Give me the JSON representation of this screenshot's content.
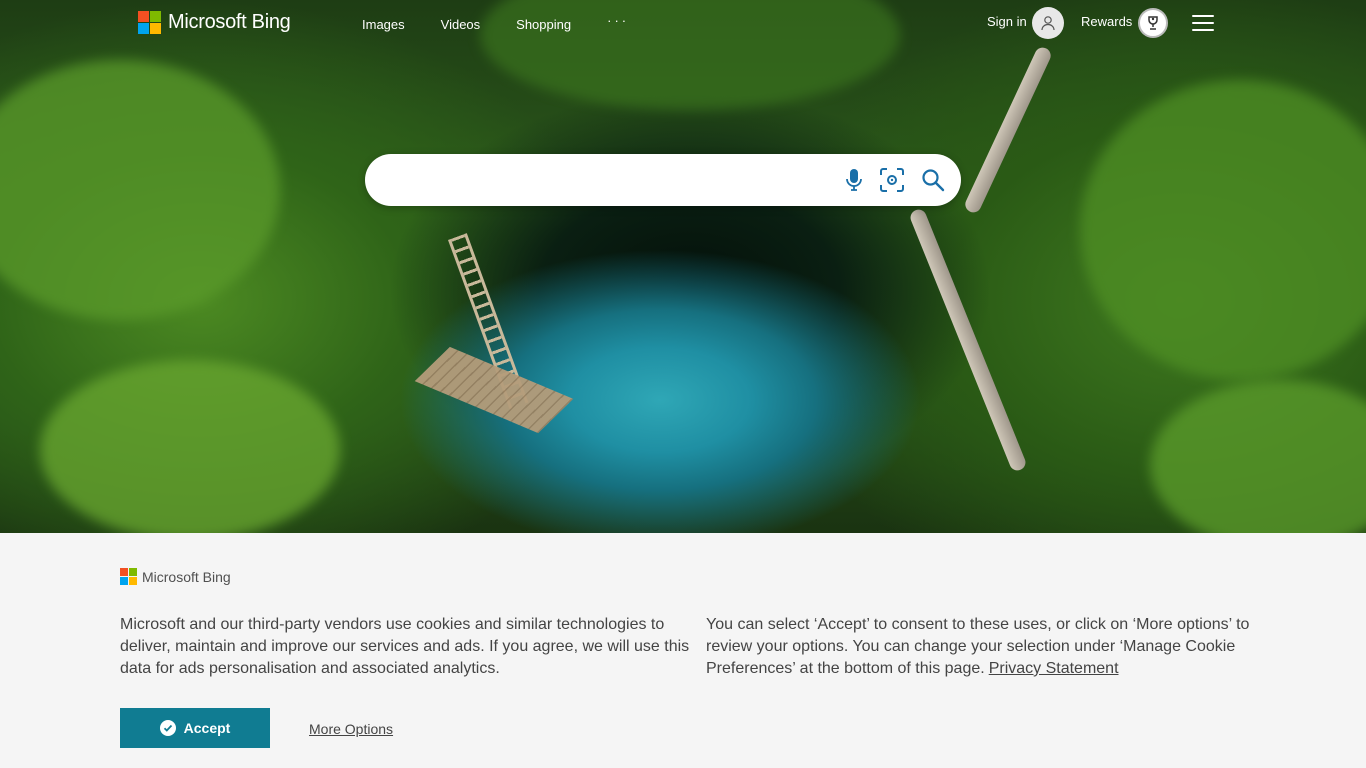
{
  "header": {
    "logo_text": "Microsoft Bing",
    "nav": [
      {
        "label": "Images"
      },
      {
        "label": "Videos"
      },
      {
        "label": "Shopping"
      }
    ],
    "more": "···",
    "signin": "Sign in",
    "rewards": "Rewards"
  },
  "search": {
    "value": "",
    "icons": [
      "microphone-icon",
      "visual-search-icon",
      "search-icon"
    ]
  },
  "cookie": {
    "logo_text": "Microsoft Bing",
    "text_left": "Microsoft and our third-party vendors use cookies and similar technologies to deliver, maintain and improve our services and ads. If you agree, we will use this data for ads personalisation and associated analytics.",
    "text_right": "You can select ‘Accept’ to consent to these uses, or click on ‘More options’ to review your options.  You can change your selection under ‘Manage Cookie Preferences’ at the bottom of this page.",
    "privacy_link": "Privacy Statement",
    "accept_label": "Accept",
    "more_options_label": "More Options"
  },
  "colors": {
    "accent": "#107c92",
    "banner_bg": "#f5f5f5"
  }
}
